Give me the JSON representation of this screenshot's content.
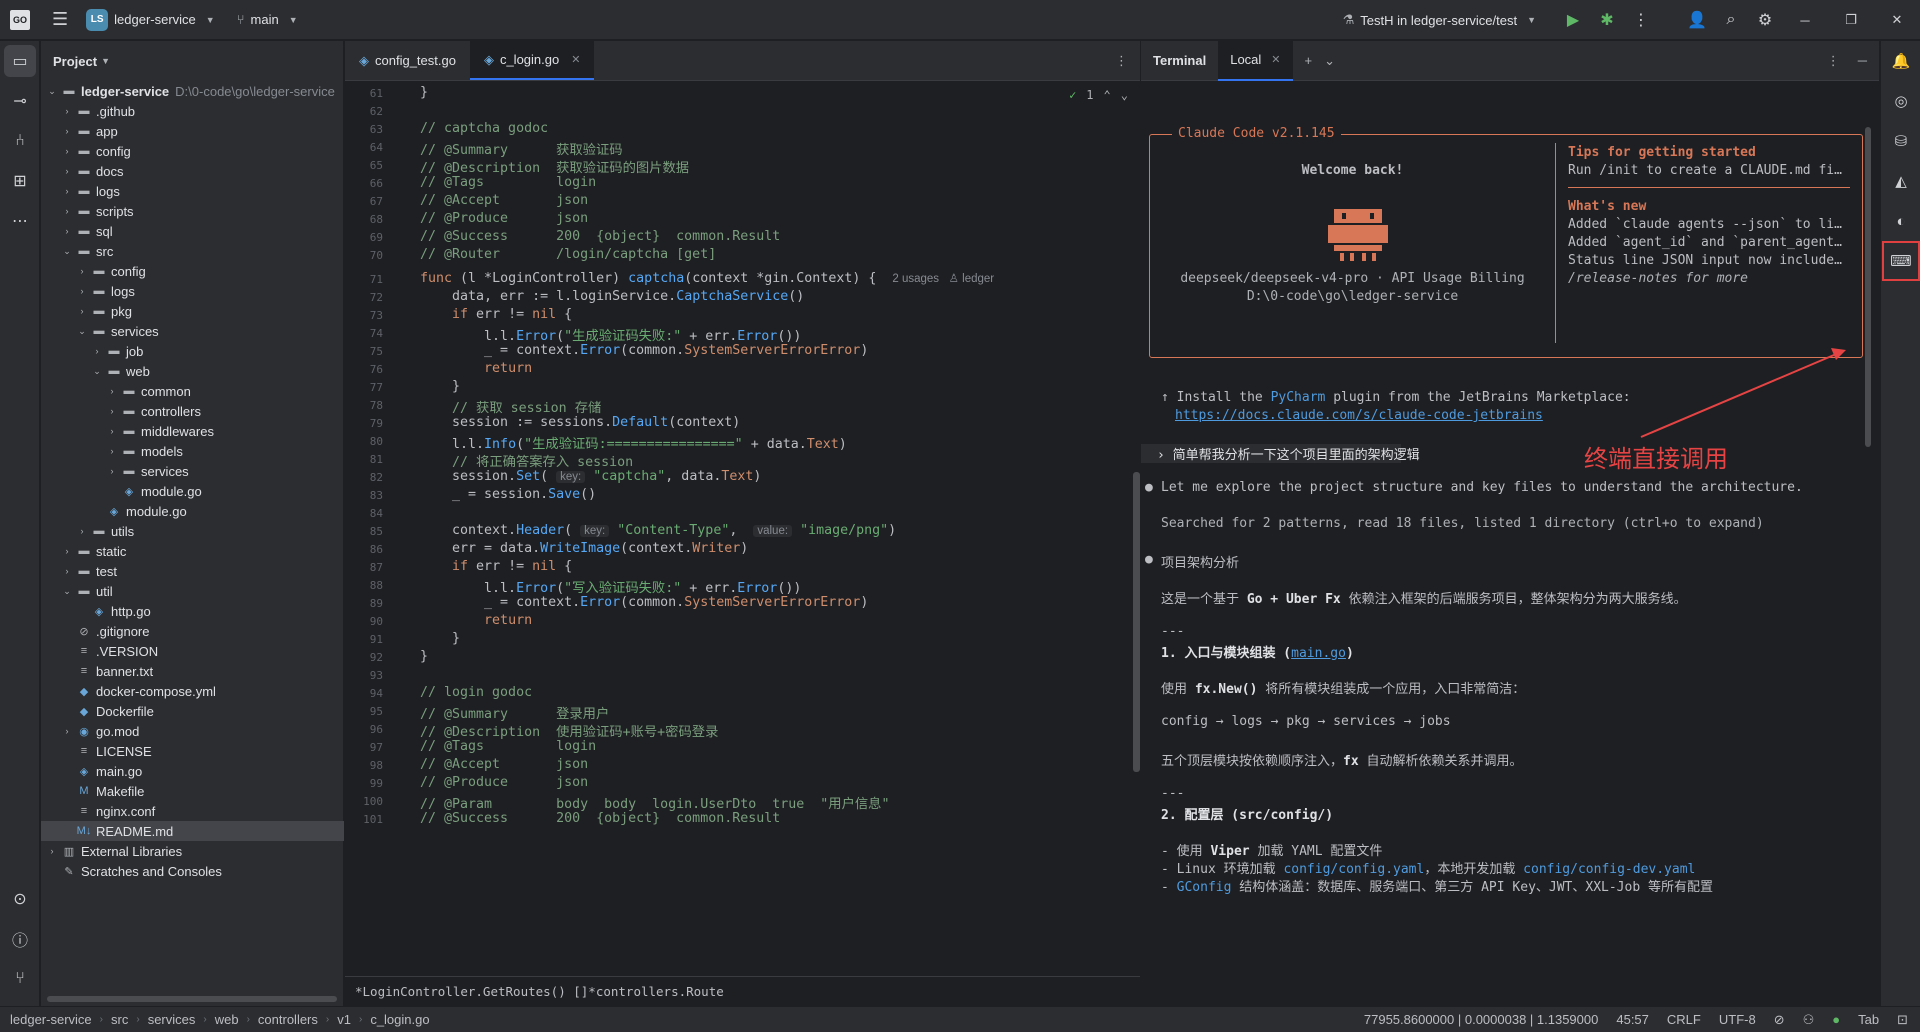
{
  "titlebar": {
    "app_logo": "GO",
    "project_badge": "LS",
    "project_name": "ledger-service",
    "branch": "main",
    "run_config": "TestH in ledger-service/test"
  },
  "project_panel": {
    "title": "Project",
    "root": {
      "name": "ledger-service",
      "path": "D:\\0-code\\go\\ledger-service"
    },
    "items": [
      {
        "label": ".github",
        "depth": 1,
        "type": "folder",
        "arrow": "closed"
      },
      {
        "label": "app",
        "depth": 1,
        "type": "folder",
        "arrow": "closed"
      },
      {
        "label": "config",
        "depth": 1,
        "type": "folder",
        "arrow": "closed"
      },
      {
        "label": "docs",
        "depth": 1,
        "type": "folder",
        "arrow": "closed"
      },
      {
        "label": "logs",
        "depth": 1,
        "type": "folder",
        "arrow": "closed"
      },
      {
        "label": "scripts",
        "depth": 1,
        "type": "folder",
        "arrow": "closed"
      },
      {
        "label": "sql",
        "depth": 1,
        "type": "folder",
        "arrow": "closed"
      },
      {
        "label": "src",
        "depth": 1,
        "type": "folder",
        "arrow": "open"
      },
      {
        "label": "config",
        "depth": 2,
        "type": "folder",
        "arrow": "closed"
      },
      {
        "label": "logs",
        "depth": 2,
        "type": "folder",
        "arrow": "closed"
      },
      {
        "label": "pkg",
        "depth": 2,
        "type": "folder",
        "arrow": "closed"
      },
      {
        "label": "services",
        "depth": 2,
        "type": "folder",
        "arrow": "open"
      },
      {
        "label": "job",
        "depth": 3,
        "type": "folder",
        "arrow": "closed"
      },
      {
        "label": "web",
        "depth": 3,
        "type": "folder",
        "arrow": "open"
      },
      {
        "label": "common",
        "depth": 4,
        "type": "folder",
        "arrow": "closed"
      },
      {
        "label": "controllers",
        "depth": 4,
        "type": "folder",
        "arrow": "closed"
      },
      {
        "label": "middlewares",
        "depth": 4,
        "type": "folder",
        "arrow": "closed"
      },
      {
        "label": "models",
        "depth": 4,
        "type": "folder",
        "arrow": "closed"
      },
      {
        "label": "services",
        "depth": 4,
        "type": "folder",
        "arrow": "closed"
      },
      {
        "label": "module.go",
        "depth": 4,
        "type": "go",
        "arrow": "none"
      },
      {
        "label": "module.go",
        "depth": 3,
        "type": "go",
        "arrow": "none"
      },
      {
        "label": "utils",
        "depth": 2,
        "type": "folder",
        "arrow": "closed"
      },
      {
        "label": "static",
        "depth": 1,
        "type": "folder",
        "arrow": "closed"
      },
      {
        "label": "test",
        "depth": 1,
        "type": "folder",
        "arrow": "closed"
      },
      {
        "label": "util",
        "depth": 1,
        "type": "folder",
        "arrow": "open"
      },
      {
        "label": "http.go",
        "depth": 2,
        "type": "go",
        "arrow": "none"
      },
      {
        "label": ".gitignore",
        "depth": 1,
        "type": "ignore",
        "arrow": "none"
      },
      {
        "label": ".VERSION",
        "depth": 1,
        "type": "text",
        "arrow": "none"
      },
      {
        "label": "banner.txt",
        "depth": 1,
        "type": "text",
        "arrow": "none"
      },
      {
        "label": "docker-compose.yml",
        "depth": 1,
        "type": "docker",
        "arrow": "none"
      },
      {
        "label": "Dockerfile",
        "depth": 1,
        "type": "docker",
        "arrow": "none"
      },
      {
        "label": "go.mod",
        "depth": 1,
        "type": "gomod",
        "arrow": "closed"
      },
      {
        "label": "LICENSE",
        "depth": 1,
        "type": "text",
        "arrow": "none"
      },
      {
        "label": "main.go",
        "depth": 1,
        "type": "go",
        "arrow": "none"
      },
      {
        "label": "Makefile",
        "depth": 1,
        "type": "make",
        "arrow": "none"
      },
      {
        "label": "nginx.conf",
        "depth": 1,
        "type": "text",
        "arrow": "none"
      },
      {
        "label": "README.md",
        "depth": 1,
        "type": "md",
        "arrow": "none",
        "selected": true
      },
      {
        "label": "External Libraries",
        "depth": 0,
        "type": "lib",
        "arrow": "closed"
      },
      {
        "label": "Scratches and Consoles",
        "depth": 0,
        "type": "scratch",
        "arrow": "none"
      }
    ]
  },
  "editor": {
    "tabs": [
      {
        "label": "config_test.go",
        "active": false
      },
      {
        "label": "c_login.go",
        "active": true
      }
    ],
    "inspection": "1",
    "lines": [
      {
        "n": "61",
        "html": "<span>}</span>"
      },
      {
        "n": "62",
        "html": ""
      },
      {
        "n": "63",
        "html": "<span class='cm'>// captcha godoc</span>"
      },
      {
        "n": "64",
        "html": "<span class='cm'>// @Summary      获取验证码</span>"
      },
      {
        "n": "65",
        "html": "<span class='cm'>// @Description  获取验证码的图片数据</span>"
      },
      {
        "n": "66",
        "html": "<span class='cm'>// @Tags         login</span>"
      },
      {
        "n": "67",
        "html": "<span class='cm'>// @Accept       json</span>"
      },
      {
        "n": "68",
        "html": "<span class='cm'>// @Produce      json</span>"
      },
      {
        "n": "69",
        "html": "<span class='cm'>// @Success      200  {object}  common.Result</span>"
      },
      {
        "n": "70",
        "html": "<span class='cm'>// @Router       /login/captcha [get]</span>"
      },
      {
        "n": "71",
        "html": "<span class='kw'>func</span> (l *<span class='typ'>LoginController</span>) <span class='fn'>captcha</span>(context *gin.<span class='typ'>Context</span>) {  <span class='meta'>2 usages   ♙ ledger</span>"
      },
      {
        "n": "72",
        "html": "    data, err := l.loginService.<span class='fn'>CaptchaService</span>()"
      },
      {
        "n": "73",
        "html": "    <span class='kw'>if</span> err != <span class='kw'>nil</span> {"
      },
      {
        "n": "74",
        "html": "        l.l.<span class='fn'>Error</span>(<span class='str'>\"生成验证码失败:\"</span> + err.<span class='fn'>Error</span>())"
      },
      {
        "n": "75",
        "html": "        _ = context.<span class='fn'>Error</span>(common.<span class='kw'>SystemServerErrorError</span>)"
      },
      {
        "n": "76",
        "html": "        <span class='kw'>return</span>"
      },
      {
        "n": "77",
        "html": "    }"
      },
      {
        "n": "78",
        "html": "    <span class='cm'>// 获取 session 存储</span>"
      },
      {
        "n": "79",
        "html": "    session := sessions.<span class='fn'>Default</span>(context)"
      },
      {
        "n": "80",
        "html": "    l.l.<span class='fn'>Info</span>(<span class='str'>\"生成验证码:================\"</span> + data.<span class='kw'>Text</span>)"
      },
      {
        "n": "81",
        "html": "    <span class='cm'>// 将正确答案存入 session</span>"
      },
      {
        "n": "82",
        "html": "    session.<span class='fn'>Set</span>( <span class='hint'>key:</span> <span class='str'>\"captcha\"</span>, data.<span class='kw'>Text</span>)"
      },
      {
        "n": "83",
        "html": "    _ = session.<span class='fn'>Save</span>()"
      },
      {
        "n": "84",
        "html": ""
      },
      {
        "n": "85",
        "html": "    context.<span class='fn'>Header</span>( <span class='hint'>key:</span> <span class='str'>\"Content-Type\"</span>,  <span class='hint'>value:</span> <span class='str'>\"image/png\"</span>)"
      },
      {
        "n": "86",
        "html": "    err = data.<span class='fn'>WriteImage</span>(context.<span class='kw'>Writer</span>)"
      },
      {
        "n": "87",
        "html": "    <span class='kw'>if</span> err != <span class='kw'>nil</span> {"
      },
      {
        "n": "88",
        "html": "        l.l.<span class='fn'>Error</span>(<span class='str'>\"写入验证码失败:\"</span> + err.<span class='fn'>Error</span>())"
      },
      {
        "n": "89",
        "html": "        _ = context.<span class='fn'>Error</span>(common.<span class='kw'>SystemServerErrorError</span>)"
      },
      {
        "n": "90",
        "html": "        <span class='kw'>return</span>"
      },
      {
        "n": "91",
        "html": "    }"
      },
      {
        "n": "92",
        "html": "}"
      },
      {
        "n": "93",
        "html": ""
      },
      {
        "n": "94",
        "html": "<span class='cm'>// login godoc</span>"
      },
      {
        "n": "95",
        "html": "<span class='cm'>// @Summary      登录用户</span>"
      },
      {
        "n": "96",
        "html": "<span class='cm'>// @Description  使用验证码+账号+密码登录</span>"
      },
      {
        "n": "97",
        "html": "<span class='cm'>// @Tags         login</span>"
      },
      {
        "n": "98",
        "html": "<span class='cm'>// @Accept       json</span>"
      },
      {
        "n": "99",
        "html": "<span class='cm'>// @Produce      json</span>"
      },
      {
        "n": "100",
        "html": "<span class='cm'>// @Param        body  body  login.UserDto  true  \"用户信息\"</span>"
      },
      {
        "n": "101",
        "html": "<span class='cm'>// @Success      200  {object}  common.Result</span>"
      }
    ],
    "footer": "*LoginController.GetRoutes() []*controllers.Route"
  },
  "terminal": {
    "tabs": {
      "title": "Terminal",
      "session": "Local"
    },
    "box_title": "Claude Code v2.1.145",
    "welcome": "Welcome back!",
    "model_line": "deepseek/deepseek-v4-pro · API Usage Billing",
    "cwd": "D:\\0-code\\go\\ledger-service",
    "tips_title": "Tips for getting started",
    "tips_line": "Run /init to create a CLAUDE.md fi…",
    "whatsnew_title": "What's new",
    "news": [
      "Added `claude agents --json` to li…",
      "Added `agent_id` and `parent_agent…",
      "Status line JSON input now include…"
    ],
    "release_notes": "/release-notes for more",
    "install_prefix": "↑ Install the ",
    "install_plugin": "PyCharm",
    "install_suffix": " plugin from the JetBrains Marketplace:",
    "install_url": "https://docs.claude.com/s/claude-code-jetbrains",
    "prompt": "简单帮我分析一下这个项目里面的架构逻辑",
    "resp1": "Let me explore the project structure and key files to understand the architecture.",
    "searched": "Searched for 2 patterns, read 18 files, listed 1 directory (ctrl+o to expand)",
    "resp2": "项目架构分析",
    "intro_a": "这是一个基于 ",
    "intro_b": "Go + Uber Fx",
    "intro_c": " 依赖注入框架的后端服务项目，整体架构分为两大服务线。",
    "sep1": "---",
    "h1_a": "1. 入口与模块组装 (",
    "h1_b": "main.go",
    "h1_c": ")",
    "p1_a": "使用 ",
    "p1_b": "fx.New()",
    "p1_c": " 将所有模块组装成一个应用，入口非常简洁：",
    "chain": "config → logs → pkg → services → jobs",
    "p2_a": "五个顶层模块按依赖顺序注入，",
    "p2_b": "fx",
    "p2_c": " 自动解析依赖关系并调用。",
    "sep2": "---",
    "h2": "2. 配置层 (src/config/)",
    "b1_a": "- 使用 ",
    "b1_b": "Viper",
    "b1_c": " 加载 YAML 配置文件",
    "b2_a": "- Linux 环境加载 ",
    "b2_b": "config/config.yaml",
    "b2_c": "，本地开发加载 ",
    "b2_d": "config/config-dev.yaml",
    "b3_a": "- ",
    "b3_b": "GConfig",
    "b3_c": " 结构体涵盖：数据库、服务端口、第三方 API Key、JWT、XXL-Job 等所有配置",
    "annotation": "终端直接调用"
  },
  "statusbar": {
    "crumbs": [
      "ledger-service",
      "src",
      "services",
      "web",
      "controllers",
      "v1",
      "c_login.go"
    ],
    "coords": "77955.8600000 | 0.0000038 | 1.1359000",
    "position": "45:57",
    "line_sep": "CRLF",
    "encoding": "UTF-8",
    "indent": "Tab"
  },
  "colors": {
    "accent": "#3574f0",
    "claude_orange": "#d77757",
    "annotation_red": "#e64444"
  }
}
